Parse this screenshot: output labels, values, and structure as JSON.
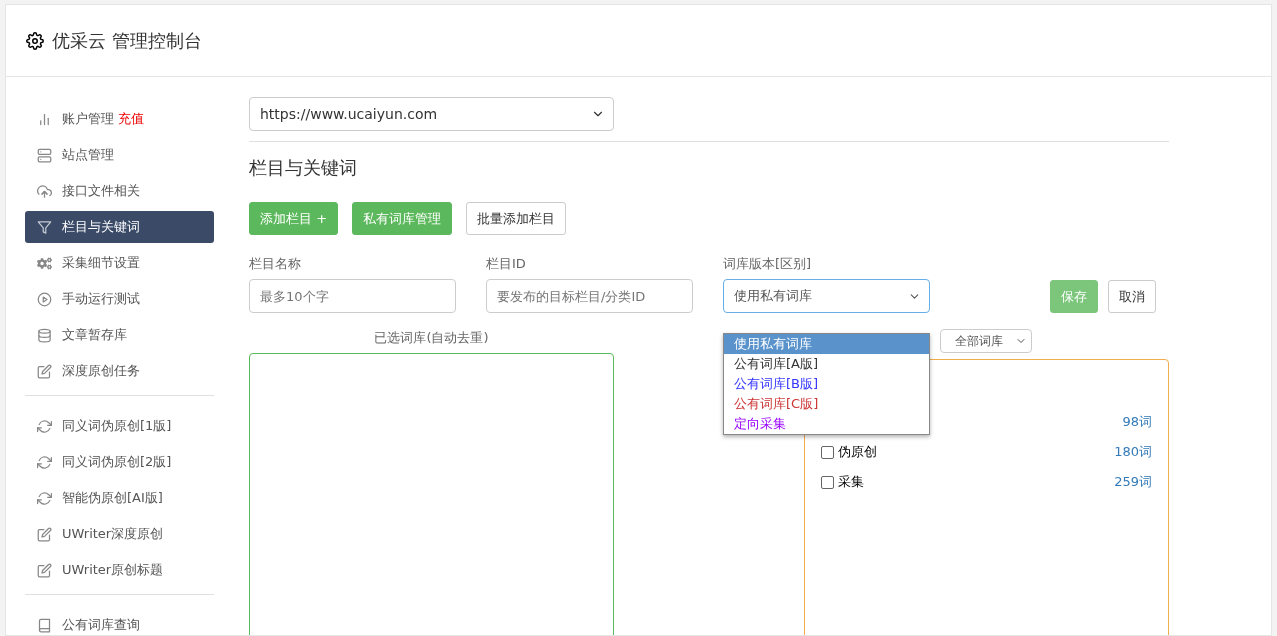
{
  "header": {
    "title": "优采云 管理控制台"
  },
  "sidebar": {
    "groups": [
      {
        "items": [
          {
            "label": "账户管理",
            "badge": "充值",
            "selected": false
          },
          {
            "label": "站点管理",
            "selected": false
          },
          {
            "label": "接口文件相关",
            "selected": false
          },
          {
            "label": "栏目与关键词",
            "selected": true
          },
          {
            "label": "采集细节设置",
            "selected": false
          },
          {
            "label": "手动运行测试",
            "selected": false
          },
          {
            "label": "文章暂存库",
            "selected": false
          },
          {
            "label": "深度原创任务",
            "selected": false
          }
        ]
      },
      {
        "items": [
          {
            "label": "同义词伪原创[1版]",
            "selected": false
          },
          {
            "label": "同义词伪原创[2版]",
            "selected": false
          },
          {
            "label": "智能伪原创[AI版]",
            "selected": false
          },
          {
            "label": "UWriter深度原创",
            "selected": false
          },
          {
            "label": "UWriter原创标题",
            "selected": false
          }
        ]
      },
      {
        "items": [
          {
            "label": "公有词库查询",
            "selected": false
          }
        ]
      }
    ]
  },
  "site_select": {
    "value": "https://www.ucaiyun.com"
  },
  "section_title": "栏目与关键词",
  "actions": [
    {
      "label": "添加栏目 +",
      "kind": "primary"
    },
    {
      "label": "私有词库管理",
      "kind": "primary"
    },
    {
      "label": "批量添加栏目",
      "kind": "default"
    }
  ],
  "form": {
    "name": {
      "label": "栏目名称",
      "placeholder": "最多10个字"
    },
    "id": {
      "label": "栏目ID",
      "placeholder": "要发布的目标栏目/分类ID"
    },
    "version": {
      "label": "词库版本[区别]",
      "value": "使用私有词库",
      "options": [
        {
          "label": "使用私有词库",
          "selected": true,
          "color": "#ffffff"
        },
        {
          "label": "公有词库[A版]",
          "selected": false,
          "color": "#333333"
        },
        {
          "label": "公有词库[B版]",
          "selected": false,
          "color": "#3333ff"
        },
        {
          "label": "公有词库[C版]",
          "selected": false,
          "color": "#cc3333"
        },
        {
          "label": "定向采集",
          "selected": false,
          "color": "#9900ff"
        }
      ]
    },
    "save": "保存",
    "cancel": "取消"
  },
  "selected_label": "已选词库(自动去重)",
  "library_filter": "全部词库",
  "libraries": [
    {
      "count": "98词"
    },
    {
      "label": "伪原创",
      "count": "180词",
      "checked": false
    },
    {
      "label": "采集",
      "count": "259词",
      "checked": false
    }
  ]
}
